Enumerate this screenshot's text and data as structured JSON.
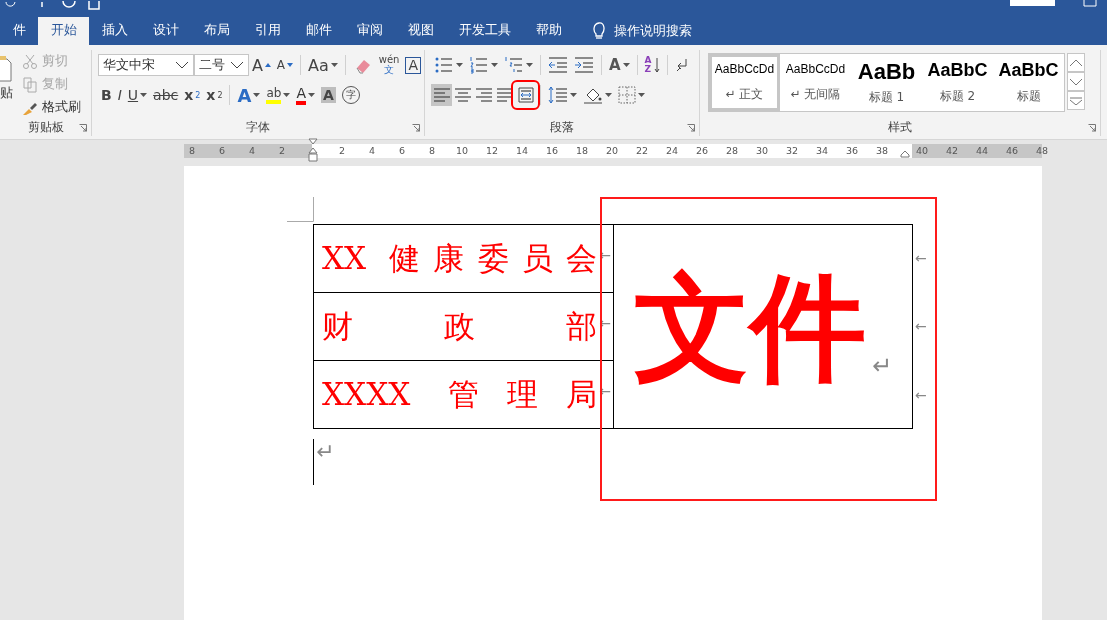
{
  "tabs": [
    {
      "label": "件",
      "selected": false
    },
    {
      "label": "开始",
      "selected": true
    },
    {
      "label": "插入",
      "selected": false
    },
    {
      "label": "设计",
      "selected": false
    },
    {
      "label": "布局",
      "selected": false
    },
    {
      "label": "引用",
      "selected": false
    },
    {
      "label": "邮件",
      "selected": false
    },
    {
      "label": "审阅",
      "selected": false
    },
    {
      "label": "视图",
      "selected": false
    },
    {
      "label": "开发工具",
      "selected": false
    },
    {
      "label": "帮助",
      "selected": false
    }
  ],
  "tell_me": {
    "label": "操作说明搜索"
  },
  "clipboard": {
    "paste_label": "贴",
    "group_label": "剪贴板",
    "items": [
      {
        "kind": "cut",
        "label": "剪切",
        "disabled": true
      },
      {
        "kind": "copy",
        "label": "复制",
        "disabled": true
      },
      {
        "kind": "painter",
        "label": "格式刷",
        "disabled": false
      }
    ]
  },
  "font": {
    "font_name": "华文中宋",
    "font_size": "二号",
    "group_label": "字体",
    "row1": [
      {
        "kind": "grow",
        "label": "A"
      },
      {
        "kind": "shrink",
        "label": "A"
      },
      {
        "kind": "case",
        "label": "Aa"
      },
      {
        "kind": "clear"
      },
      {
        "kind": "phonetic",
        "label": "wén",
        "sublabel": "文"
      },
      {
        "kind": "border",
        "label": "A"
      }
    ],
    "row2": [
      {
        "kind": "bold",
        "label": "B"
      },
      {
        "kind": "italic",
        "label": "I"
      },
      {
        "kind": "underline",
        "label": "U"
      },
      {
        "kind": "strike",
        "label": "abc"
      },
      {
        "kind": "sub",
        "label": "x",
        "sublabel": "2"
      },
      {
        "kind": "sup",
        "label": "x",
        "sublabel": "2"
      },
      {
        "kind": "effect",
        "label": "A"
      },
      {
        "kind": "highlight",
        "label": "ab"
      },
      {
        "kind": "color",
        "label": "A"
      },
      {
        "kind": "shade",
        "label": "A"
      },
      {
        "kind": "enclose",
        "label": "字"
      }
    ]
  },
  "paragraph": {
    "group_label": "段落",
    "row1": [
      {
        "kind": "bullets"
      },
      {
        "kind": "numbering"
      },
      {
        "kind": "multilevel"
      },
      {
        "kind": "outdent"
      },
      {
        "kind": "indent"
      },
      {
        "kind": "asian",
        "label": "A"
      },
      {
        "kind": "sort",
        "label": "A",
        "sublabel": "Z"
      },
      {
        "kind": "marks"
      }
    ],
    "alignments": [
      {
        "kind": "left",
        "selected": true,
        "highlighted": false
      },
      {
        "kind": "center",
        "selected": false,
        "highlighted": false
      },
      {
        "kind": "right",
        "selected": false,
        "highlighted": false
      },
      {
        "kind": "justify",
        "selected": false,
        "highlighted": false
      },
      {
        "kind": "distributed",
        "selected": false,
        "highlighted": true
      }
    ],
    "row2": [
      {
        "kind": "spacing"
      },
      {
        "kind": "shading"
      },
      {
        "kind": "borders"
      }
    ]
  },
  "styles": {
    "group_label": "样式",
    "items": [
      {
        "kind": "normal",
        "preview": "AaBbCcDd",
        "name": "↵ 正文",
        "selected": true
      },
      {
        "kind": "normal",
        "preview": "AaBbCcDd",
        "name": "↵ 无间隔",
        "selected": false
      },
      {
        "kind": "heading1",
        "preview": "AaBb",
        "name": "标题 1",
        "selected": false
      },
      {
        "kind": "heading2",
        "preview": "AaBbC",
        "name": "标题 2",
        "selected": false
      },
      {
        "kind": "title",
        "preview": "AaBbC",
        "name": "标题",
        "selected": false
      }
    ]
  },
  "ruler": {
    "left_ticks": [
      "8",
      "6",
      "4",
      "2"
    ],
    "ticks": [
      "2",
      "4",
      "6",
      "8",
      "10",
      "12",
      "14",
      "16",
      "18",
      "20",
      "22",
      "24",
      "26",
      "28",
      "30",
      "32",
      "34",
      "36",
      "38"
    ],
    "right_ticks": [
      "40",
      "42",
      "44",
      "46",
      "48"
    ]
  },
  "document": {
    "table": {
      "rows": [
        {
          "text": "XX 健康委员会",
          "cell_mark": "←",
          "row_mark": "←"
        },
        {
          "text": "财政部",
          "cell_mark": "←",
          "row_mark": "←"
        },
        {
          "text": "XXXX 管理局",
          "cell_mark": "←",
          "row_mark": "←"
        }
      ],
      "merged_cell": {
        "text": "文件",
        "mark": "↵",
        "highlighted": true
      }
    },
    "after_mark": "↵"
  }
}
